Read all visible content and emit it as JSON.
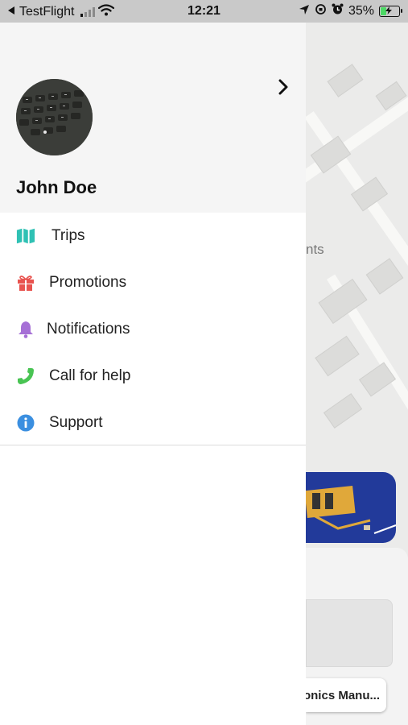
{
  "status_bar": {
    "back_app": "TestFlight",
    "time": "12:21",
    "battery_percent": "35%",
    "battery_level": 0.35,
    "battery_color": "#4cd964",
    "icons": [
      "back-arrow-icon",
      "cellular-signal-icon",
      "wifi-icon",
      "location-icon",
      "screen-rotation-lock-icon",
      "alarm-icon",
      "battery-charging-icon"
    ]
  },
  "drawer": {
    "user_name": "John Doe",
    "header_background": "#f5f5f5",
    "menu": [
      {
        "label": "Trips",
        "icon": "map-icon",
        "color": "#2fc1b4"
      },
      {
        "label": "Promotions",
        "icon": "gift-icon",
        "color": "#e8534f"
      },
      {
        "label": "Notifications",
        "icon": "bell-icon",
        "color": "#a670d6"
      },
      {
        "label": "Call for help",
        "icon": "phone-icon",
        "color": "#49c453"
      },
      {
        "label": "Support",
        "icon": "info-icon",
        "color": "#3b8fe0"
      }
    ]
  },
  "background": {
    "map_label_fragment": "nts",
    "button_label_fragment": "onics Manu..."
  }
}
